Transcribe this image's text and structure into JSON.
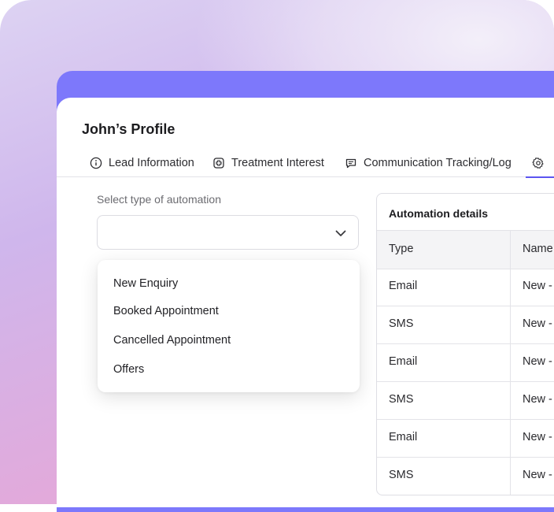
{
  "profile": {
    "title": "John’s Profile"
  },
  "tabs": [
    {
      "label": "Lead Information",
      "icon": "info-icon"
    },
    {
      "label": "Treatment Interest",
      "icon": "medical-plus-icon"
    },
    {
      "label": "Communication Tracking/Log",
      "icon": "chat-icon"
    },
    {
      "label": "",
      "icon": "gear-icon"
    }
  ],
  "automation": {
    "select_label": "Select type of automation",
    "select_value": "",
    "options": [
      "New Enquiry",
      "Booked Appointment",
      "Cancelled Appointment",
      "Offers"
    ]
  },
  "details": {
    "title": "Automation details",
    "columns": [
      "Type",
      "Name"
    ],
    "rows": [
      {
        "type": "Email",
        "name": "New -"
      },
      {
        "type": "SMS",
        "name": "New -"
      },
      {
        "type": "Email",
        "name": "New -"
      },
      {
        "type": "SMS",
        "name": "New -"
      },
      {
        "type": "Email",
        "name": "New -"
      },
      {
        "type": "SMS",
        "name": "New -"
      }
    ]
  },
  "colors": {
    "accent": "#7d78fb",
    "active_tab_underline": "#5b55f0"
  }
}
